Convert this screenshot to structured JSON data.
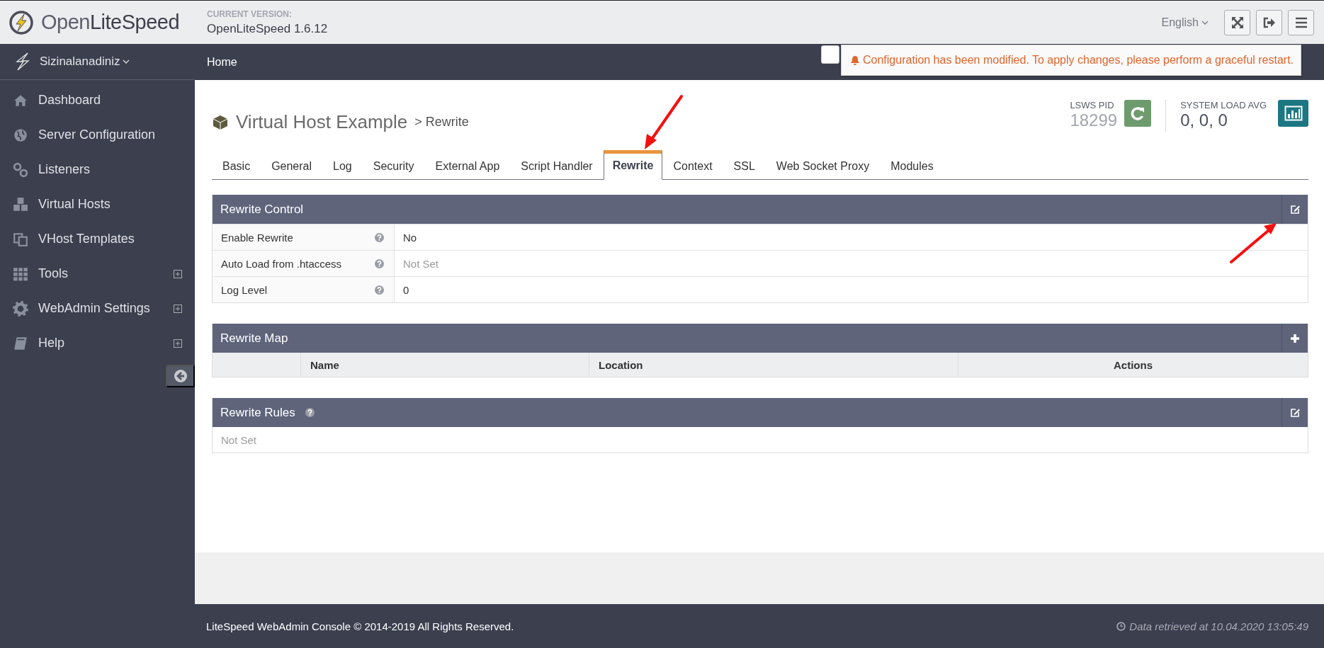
{
  "header": {
    "logo": "Open**LiteSpeed**",
    "version_label": "CURRENT VERSION:",
    "version": "OpenLiteSpeed 1.6.12",
    "language": "English"
  },
  "nav": {
    "server": "Sizinalanadiniz",
    "breadcrumb": "Home"
  },
  "alert": {
    "checked": false,
    "message": "Configuration has been modified. To apply changes, please perform a graceful restart."
  },
  "sidebar": {
    "items": [
      {
        "label": "Dashboard",
        "expandable": false
      },
      {
        "label": "Server Configuration",
        "expandable": false
      },
      {
        "label": "Listeners",
        "expandable": false
      },
      {
        "label": "Virtual Hosts",
        "expandable": false
      },
      {
        "label": "VHost Templates",
        "expandable": false
      },
      {
        "label": "Tools",
        "expandable": true
      },
      {
        "label": "WebAdmin Settings",
        "expandable": true
      },
      {
        "label": "Help",
        "expandable": true
      }
    ]
  },
  "page": {
    "title": "Virtual Host Example",
    "subtitle": "> Rewrite",
    "pid_label": "LSWS PID",
    "pid": "18299",
    "load_label": "SYSTEM LOAD AVG",
    "load": "0, 0, 0"
  },
  "tabs": [
    {
      "label": "Basic",
      "selected": false
    },
    {
      "label": "General",
      "selected": false
    },
    {
      "label": "Log",
      "selected": false
    },
    {
      "label": "Security",
      "selected": false
    },
    {
      "label": "External App",
      "selected": false
    },
    {
      "label": "Script Handler",
      "selected": false
    },
    {
      "label": "Rewrite",
      "selected": true
    },
    {
      "label": "Context",
      "selected": false
    },
    {
      "label": "SSL",
      "selected": false
    },
    {
      "label": "Web Socket Proxy",
      "selected": false
    },
    {
      "label": "Modules",
      "selected": false
    }
  ],
  "rewrite_control": {
    "title": "Rewrite Control",
    "rows": [
      {
        "label": "Enable Rewrite",
        "value": "No",
        "set": true
      },
      {
        "label": "Auto Load from .htaccess",
        "value": "Not Set",
        "set": false
      },
      {
        "label": "Log Level",
        "value": "0",
        "set": true
      }
    ]
  },
  "rewrite_map": {
    "title": "Rewrite Map",
    "columns": [
      "Name",
      "Location",
      "Actions"
    ]
  },
  "rewrite_rules": {
    "title": "Rewrite Rules",
    "value": "Not Set"
  },
  "footer": {
    "copyright": "LiteSpeed WebAdmin Console © 2014-2019 All Rights Reserved.",
    "retrieved": "Data retrieved at 10.04.2020 13:05:49"
  }
}
